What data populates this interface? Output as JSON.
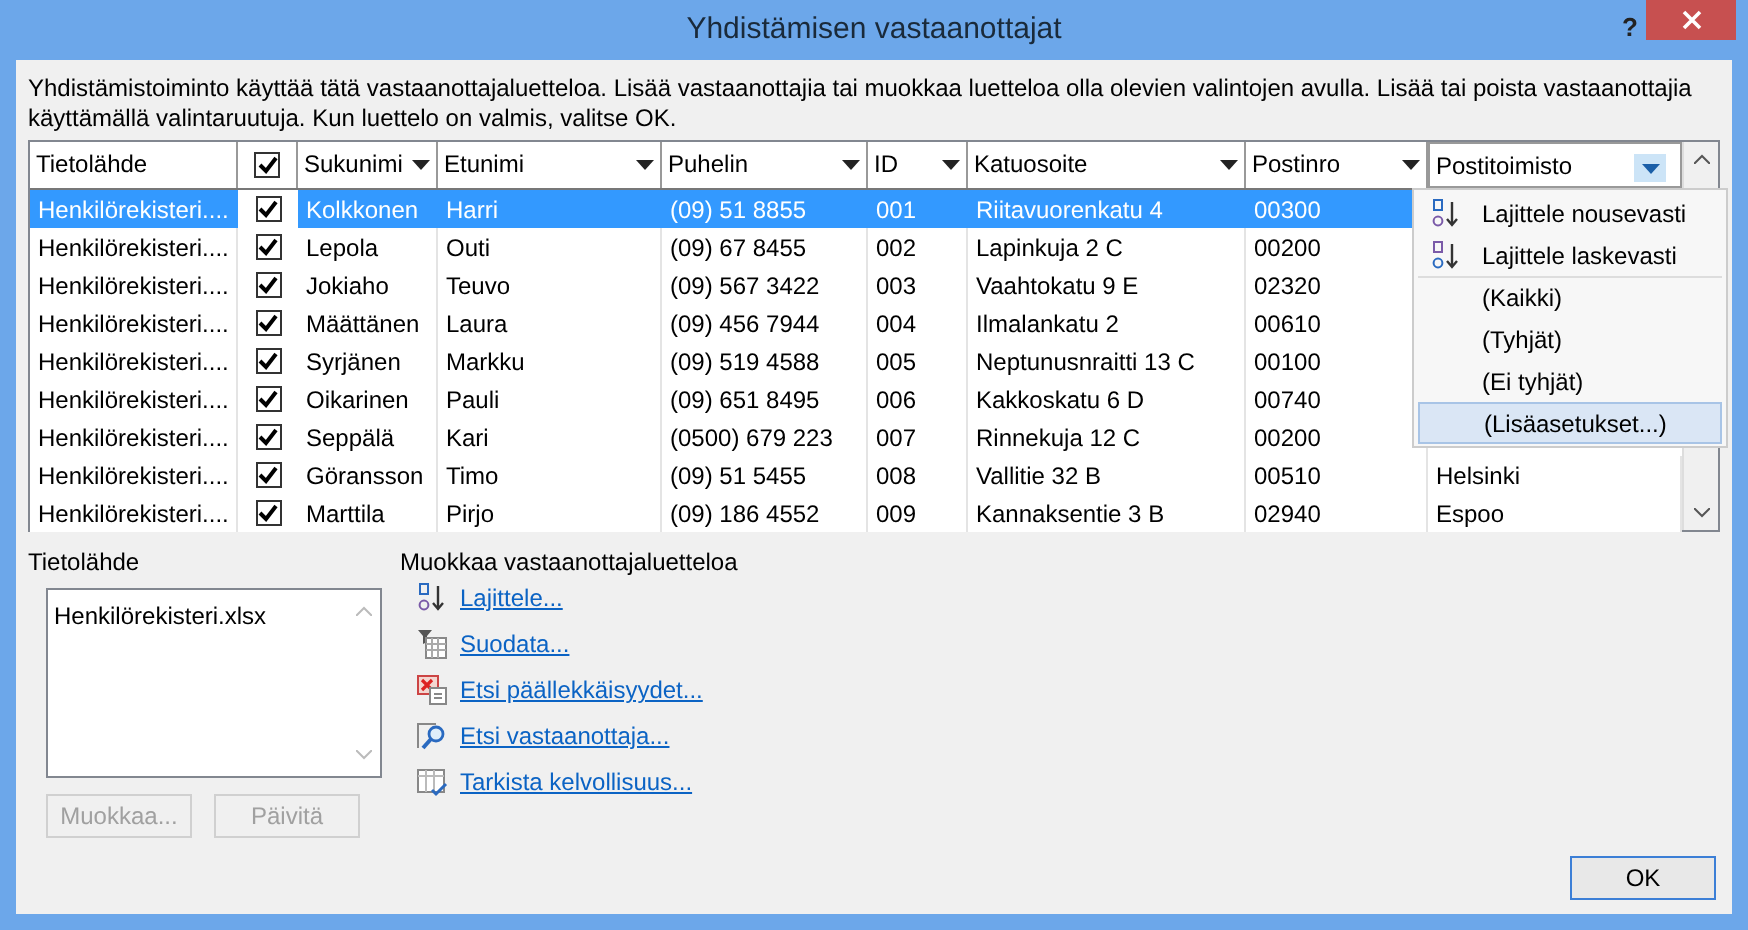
{
  "window": {
    "title": "Yhdistämisen vastaanottajat",
    "help": "?"
  },
  "intro": "Yhdistämistoiminto käyttää tätä vastaanottajaluetteloa. Lisää vastaanottajia tai muokkaa luetteloa olla olevien valintojen avulla. Lisää tai poista vastaanottajia käyttämällä valintaruutuja. Kun luettelo on valmis, valitse OK.",
  "table": {
    "columns": [
      {
        "label": "Tietolähde",
        "kind": "plain"
      },
      {
        "kind": "check",
        "checked": true
      },
      {
        "label": "Sukunimi",
        "kind": "drop"
      },
      {
        "label": "Etunimi",
        "kind": "drop"
      },
      {
        "label": "Puhelin",
        "kind": "drop"
      },
      {
        "label": "ID",
        "kind": "drop"
      },
      {
        "label": "Katuosoite",
        "kind": "drop"
      },
      {
        "label": "Postinro",
        "kind": "drop"
      },
      {
        "label": "Postitoimisto",
        "kind": "active"
      }
    ],
    "rows": [
      {
        "selected": true,
        "cells": [
          "Henkilörekisteri....",
          {
            "checked": true
          },
          "Kolkkonen",
          "Harri",
          "(09) 51 8855",
          "001",
          "Riitavuorenkatu 4",
          "00300"
        ]
      },
      {
        "selected": false,
        "cells": [
          "Henkilörekisteri....",
          {
            "checked": true
          },
          "Lepola",
          "Outi",
          "(09) 67 8455",
          "002",
          "Lapinkuja 2 C",
          "00200"
        ]
      },
      {
        "selected": false,
        "cells": [
          "Henkilörekisteri....",
          {
            "checked": true
          },
          "Jokiaho",
          "Teuvo",
          "(09) 567 3422",
          "003",
          "Vaahtokatu 9 E",
          "02320"
        ]
      },
      {
        "selected": false,
        "cells": [
          "Henkilörekisteri....",
          {
            "checked": true
          },
          "Määttänen",
          "Laura",
          "(09) 456 7944",
          "004",
          "Ilmalankatu 2",
          "00610"
        ]
      },
      {
        "selected": false,
        "cells": [
          "Henkilörekisteri....",
          {
            "checked": true
          },
          "Syrjänen",
          "Markku",
          "(09) 519 4588",
          "005",
          "Neptunusnraitti 13 C",
          "00100"
        ]
      },
      {
        "selected": false,
        "cells": [
          "Henkilörekisteri....",
          {
            "checked": true
          },
          "Oikarinen",
          "Pauli",
          "(09) 651 8495",
          "006",
          "Kakkoskatu 6 D",
          "00740"
        ]
      },
      {
        "selected": false,
        "cells": [
          "Henkilörekisteri....",
          {
            "checked": true
          },
          "Seppälä",
          "Kari",
          "(0500) 679 223",
          "007",
          "Rinnekuja 12 C",
          "00200"
        ]
      },
      {
        "selected": false,
        "cells": [
          "Henkilörekisteri....",
          {
            "checked": true
          },
          "Göransson",
          "Timo",
          "(09) 51 5455",
          "008",
          "Vallitie 32 B",
          "00510",
          "Helsinki"
        ]
      },
      {
        "selected": false,
        "cells": [
          "Henkilörekisteri....",
          {
            "checked": true
          },
          "Marttila",
          "Pirjo",
          "(09) 186 4552",
          "009",
          "Kannaksentie 3 B",
          "02940",
          "Espoo"
        ]
      }
    ]
  },
  "filter_menu": {
    "items": [
      {
        "kind": "sort_asc",
        "label": "Lajittele nousevasti",
        "selected": false
      },
      {
        "kind": "sort_desc",
        "label": "Lajittele laskevasti",
        "selected": false
      },
      {
        "kind": "option",
        "label": "(Kaikki)",
        "selected": false
      },
      {
        "kind": "option",
        "label": "(Tyhjät)",
        "selected": false
      },
      {
        "kind": "option",
        "label": "(Ei tyhjät)",
        "selected": false
      },
      {
        "kind": "option",
        "label": "(Lisäasetukset...)",
        "selected": true
      }
    ]
  },
  "data_source": {
    "label": "Tietolähde",
    "items": [
      "Henkilörekisteri.xlsx"
    ],
    "buttons": [
      {
        "label": "Muokkaa...",
        "disabled": true
      },
      {
        "label": "Päivitä",
        "disabled": true
      }
    ]
  },
  "edit_list": {
    "label": "Muokkaa vastaanottajaluetteloa",
    "links": [
      {
        "kind": "sort",
        "label": "Lajittele..."
      },
      {
        "kind": "filter",
        "label": "Suodata..."
      },
      {
        "kind": "duplicates",
        "label": "Etsi päällekkäisyydet..."
      },
      {
        "kind": "find",
        "label": "Etsi vastaanottaja..."
      },
      {
        "kind": "validate",
        "label": "Tarkista kelvollisuus..."
      }
    ]
  },
  "ok_button": "OK"
}
